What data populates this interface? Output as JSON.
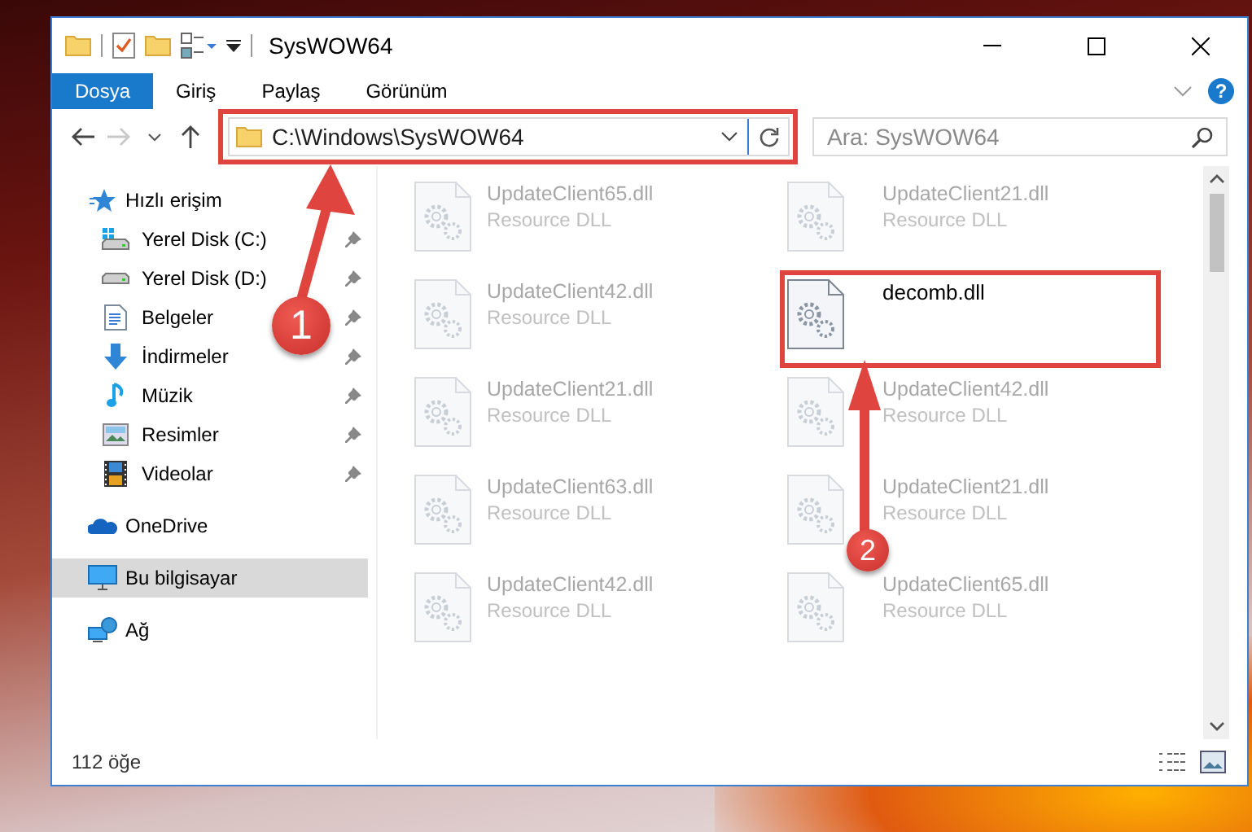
{
  "window": {
    "title": "SysWOW64"
  },
  "ribbon": {
    "tabs": [
      {
        "label": "Dosya",
        "selected": true
      },
      {
        "label": "Giriş",
        "selected": false
      },
      {
        "label": "Paylaş",
        "selected": false
      },
      {
        "label": "Görünüm",
        "selected": false
      }
    ],
    "help": "?"
  },
  "navigation": {
    "forward_disabled": true
  },
  "address_bar": {
    "path": "C:\\Windows\\SysWOW64"
  },
  "search": {
    "placeholder": "Ara: SysWOW64"
  },
  "sidebar": {
    "items": [
      {
        "label": "Hızlı erişim",
        "kind": "star",
        "selected": false,
        "children": [
          {
            "label": "Yerel Disk (C:)",
            "kind": "system-drive",
            "pinned": true,
            "selected": false
          },
          {
            "label": "Yerel Disk (D:)",
            "kind": "drive",
            "pinned": true,
            "selected": false
          },
          {
            "label": "Belgeler",
            "kind": "documents",
            "pinned": true,
            "selected": false
          },
          {
            "label": "İndirmeler",
            "kind": "downloads",
            "pinned": true,
            "selected": false
          },
          {
            "label": "Müzik",
            "kind": "music",
            "pinned": true,
            "selected": false
          },
          {
            "label": "Resimler",
            "kind": "pictures",
            "pinned": true,
            "selected": false
          },
          {
            "label": "Videolar",
            "kind": "videos",
            "pinned": true,
            "selected": false
          }
        ]
      },
      {
        "label": "OneDrive",
        "kind": "cloud",
        "selected": false
      },
      {
        "label": "Bu bilgisayar",
        "kind": "computer",
        "selected": true
      },
      {
        "label": "Ağ",
        "kind": "network",
        "selected": false
      }
    ]
  },
  "files": [
    {
      "name": "UpdateClient65.dll",
      "type": "Resource DLL",
      "blurred": true
    },
    {
      "name": "UpdateClient21.dll",
      "type": "Resource DLL",
      "blurred": true
    },
    {
      "name": "UpdateClient42.dll",
      "type": "Resource DLL",
      "blurred": true
    },
    {
      "name": "decomb.dll",
      "blurred": false
    },
    {
      "name": "UpdateClient21.dll",
      "type": "Resource DLL",
      "blurred": true
    },
    {
      "name": "UpdateClient42.dll",
      "type": "Resource DLL",
      "blurred": true
    },
    {
      "name": "UpdateClient63.dll",
      "type": "Resource DLL",
      "blurred": true
    },
    {
      "name": "UpdateClient21.dll",
      "type": "Resource DLL",
      "blurred": true
    },
    {
      "name": "UpdateClient42.dll",
      "type": "Resource DLL",
      "blurred": true
    },
    {
      "name": "UpdateClient65.dll",
      "type": "Resource DLL",
      "blurred": true
    }
  ],
  "status_bar": {
    "item_count": "112 öğe"
  },
  "annotations": [
    {
      "number": "1"
    },
    {
      "number": "2"
    }
  ]
}
